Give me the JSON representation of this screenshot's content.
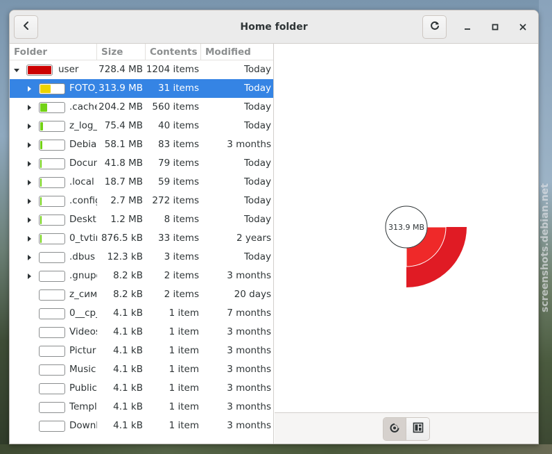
{
  "window": {
    "title": "Home folder"
  },
  "icons": {
    "back": "go-previous-icon",
    "reload": "view-refresh-icon",
    "minimize": "minimize-icon",
    "maximize": "maximize-icon",
    "close": "close-icon",
    "rings_view": "rings-chart-icon",
    "treemap_view": "treemap-chart-icon"
  },
  "columns": {
    "folder": "Folder",
    "size": "Size",
    "contents": "Contents",
    "modified": "Modified"
  },
  "rows": [
    {
      "name": "user",
      "size": "728.4 MB",
      "contents": "1204 items",
      "modified": "Today",
      "depth": 0,
      "expander": "expanded",
      "usage": 1.0,
      "color": "#cc0000"
    },
    {
      "name": "FOTO_",
      "size": "313.9 MB",
      "contents": "31 items",
      "modified": "Today",
      "depth": 1,
      "expander": "collapsed",
      "usage": 0.431,
      "color": "#edd400",
      "selected": true
    },
    {
      "name": ".cache",
      "size": "204.2 MB",
      "contents": "560 items",
      "modified": "Today",
      "depth": 1,
      "expander": "collapsed",
      "usage": 0.28,
      "color": "#73d216"
    },
    {
      "name": "z_log_",
      "size": "75.4 MB",
      "contents": "40 items",
      "modified": "Today",
      "depth": 1,
      "expander": "collapsed",
      "usage": 0.104,
      "color": "#73d216"
    },
    {
      "name": "Debia",
      "size": "58.1 MB",
      "contents": "83 items",
      "modified": "3 months",
      "depth": 1,
      "expander": "collapsed",
      "usage": 0.08,
      "color": "#73d216"
    },
    {
      "name": "Docun",
      "size": "41.8 MB",
      "contents": "79 items",
      "modified": "Today",
      "depth": 1,
      "expander": "collapsed",
      "usage": 0.057,
      "color": "#73d216"
    },
    {
      "name": ".local",
      "size": "18.7 MB",
      "contents": "59 items",
      "modified": "Today",
      "depth": 1,
      "expander": "collapsed",
      "usage": 0.026,
      "color": "#73d216"
    },
    {
      "name": ".config",
      "size": "2.7 MB",
      "contents": "272 items",
      "modified": "Today",
      "depth": 1,
      "expander": "collapsed",
      "usage": 0.004,
      "color": "#73d216"
    },
    {
      "name": "Deskt",
      "size": "1.2 MB",
      "contents": "8 items",
      "modified": "Today",
      "depth": 1,
      "expander": "collapsed",
      "usage": 0.002,
      "color": "#73d216"
    },
    {
      "name": "0_tvtir",
      "size": "876.5 kB",
      "contents": "33 items",
      "modified": "2 years",
      "depth": 1,
      "expander": "collapsed",
      "usage": 0.001,
      "color": "#73d216"
    },
    {
      "name": ".dbus",
      "size": "12.3 kB",
      "contents": "3 items",
      "modified": "Today",
      "depth": 1,
      "expander": "collapsed",
      "usage": 0.0,
      "color": "#73d216"
    },
    {
      "name": ".gnupg",
      "size": "8.2 kB",
      "contents": "2 items",
      "modified": "3 months",
      "depth": 1,
      "expander": "collapsed",
      "usage": 0.0,
      "color": "#73d216"
    },
    {
      "name": "z_сим",
      "size": "8.2 kB",
      "contents": "2 items",
      "modified": "20 days",
      "depth": 1,
      "expander": "none",
      "usage": 0.0,
      "color": "#73d216"
    },
    {
      "name": "0__cp_",
      "size": "4.1 kB",
      "contents": "1 item",
      "modified": "7 months",
      "depth": 1,
      "expander": "none",
      "usage": 0.0,
      "color": "#73d216"
    },
    {
      "name": "Videos",
      "size": "4.1 kB",
      "contents": "1 item",
      "modified": "3 months",
      "depth": 1,
      "expander": "none",
      "usage": 0.0,
      "color": "#73d216"
    },
    {
      "name": "Pictur",
      "size": "4.1 kB",
      "contents": "1 item",
      "modified": "3 months",
      "depth": 1,
      "expander": "none",
      "usage": 0.0,
      "color": "#73d216"
    },
    {
      "name": "Music",
      "size": "4.1 kB",
      "contents": "1 item",
      "modified": "3 months",
      "depth": 1,
      "expander": "none",
      "usage": 0.0,
      "color": "#73d216"
    },
    {
      "name": "Public",
      "size": "4.1 kB",
      "contents": "1 item",
      "modified": "3 months",
      "depth": 1,
      "expander": "none",
      "usage": 0.0,
      "color": "#73d216"
    },
    {
      "name": "Templ",
      "size": "4.1 kB",
      "contents": "1 item",
      "modified": "3 months",
      "depth": 1,
      "expander": "none",
      "usage": 0.0,
      "color": "#73d216"
    },
    {
      "name": "Downl",
      "size": "4.1 kB",
      "contents": "1 item",
      "modified": "3 months",
      "depth": 1,
      "expander": "none",
      "usage": 0.0,
      "color": "#73d216"
    }
  ],
  "chart": {
    "center_label": "313.9 MB",
    "colors": {
      "outer": "#e01b24",
      "inner": "#ef2929",
      "center_border": "#2e3436"
    }
  },
  "background": {
    "watermark": "screenshots.debian.net"
  }
}
